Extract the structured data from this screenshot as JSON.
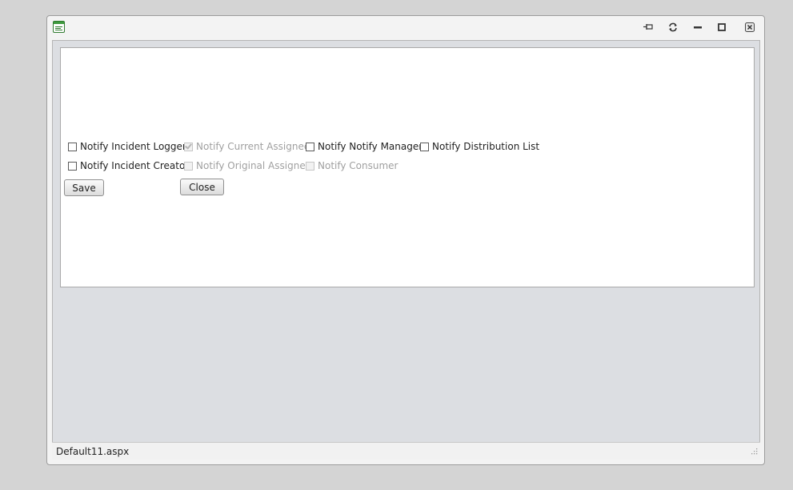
{
  "window": {
    "controls": [
      {
        "icon": "pin-icon"
      },
      {
        "icon": "refresh-icon"
      },
      {
        "icon": "minimize-icon"
      },
      {
        "icon": "maximize-icon"
      },
      {
        "icon": "close-icon"
      }
    ]
  },
  "form": {
    "notify_incident_logger": {
      "label": "Notify Incident Logger",
      "checked": false,
      "disabled": false
    },
    "notify_current_assignee": {
      "label": "Notify Current Assignee",
      "checked": true,
      "disabled": true
    },
    "notify_notify_manager": {
      "label": "Notify Notify Manager",
      "checked": false,
      "disabled": false
    },
    "notify_distribution_list": {
      "label": "Notify Distribution List",
      "checked": false,
      "disabled": false
    },
    "notify_incident_creator": {
      "label": "Notify Incident Creator",
      "checked": false,
      "disabled": false
    },
    "notify_original_assignee": {
      "label": "Notify Original Assignee",
      "checked": false,
      "disabled": true
    },
    "notify_consumer": {
      "label": "Notify Consumer",
      "checked": false,
      "disabled": true
    },
    "save_label": "Save",
    "close_label": "Close"
  },
  "status": {
    "page": "Default11.aspx"
  }
}
